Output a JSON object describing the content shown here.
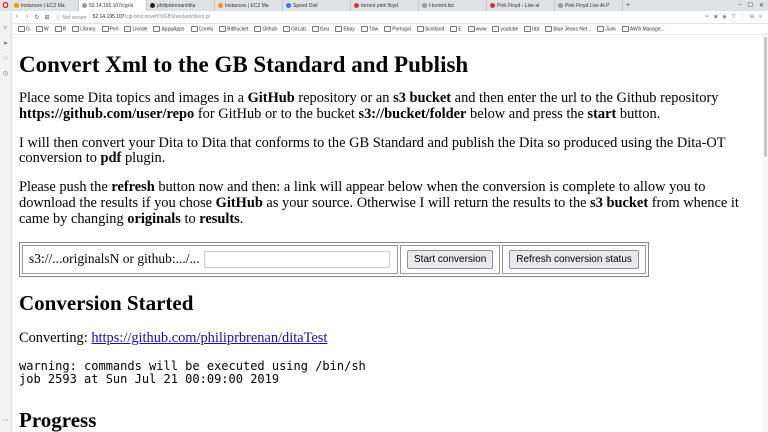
{
  "browser": {
    "tabs": [
      {
        "label": "Instances | EC2 Ma",
        "color": "#f29900",
        "active": false
      },
      {
        "label": "52.14.195.107/cgi-b",
        "color": "#999999",
        "active": true
      },
      {
        "label": "philiprbrenan/dita",
        "color": "#222222",
        "active": false
      },
      {
        "label": "Instances | EC2 Ma",
        "color": "#f29900",
        "active": false
      },
      {
        "label": "Speed Dial",
        "color": "#3478f6",
        "active": false
      },
      {
        "label": "torrent pink floyd",
        "color": "#d33",
        "active": false
      },
      {
        "label": "l-torrent.biz",
        "color": "#999999",
        "active": false
      },
      {
        "label": "Pink Floyd - Live at",
        "color": "#d33",
        "active": false
      },
      {
        "label": "Pink Floyd Live At P",
        "color": "#999999",
        "active": false
      }
    ],
    "new_tab": "+",
    "nav": {
      "back": "‹",
      "forward": "›",
      "reload": "↻",
      "grid": "⊞"
    },
    "security": "ⓘ Not secure",
    "url_host": "52.14.195.107",
    "url_path": "/cgi-bin/convertToGBStandard/client.pl",
    "bookmarks": [
      "G",
      "W",
      "R",
      "Library",
      "Perl",
      "Linode",
      "AppaApps",
      "Corelu",
      "BitBucket",
      "Github",
      "GitLab",
      "Gnu",
      "Ebay",
      "Tdw",
      "Portugal",
      "Scotland",
      "E",
      "www",
      "youtube",
      "bbt",
      "Blue Jeans Net...",
      "Junk",
      "AWS Manage..."
    ]
  },
  "page": {
    "title": "Convert Xml to the GB Standard and Publish",
    "p1": {
      "t1": "Place some Dita topics and images in a ",
      "b1": "GitHub",
      "t2": " repository or an ",
      "b2": "s3 bucket",
      "t3": " and then enter the url to the Github repository ",
      "b3": "https://github.com/user/repo",
      "t4": " for GitHub or to the bucket ",
      "b4": "s3://bucket/folder",
      "t5": " below and press the ",
      "b5": "start",
      "t6": " button."
    },
    "p2": {
      "t1": "I will then convert your Dita to Dita that conforms to the GB Standard and publish the Dita so produced using the Dita-OT conversion to ",
      "b1": "pdf",
      "t2": " plugin."
    },
    "p3": {
      "t1": "Please push the ",
      "b1": "refresh",
      "t2": " button now and then: a link will appear below when the conversion is complete to allow you to download the results if you chose ",
      "b2": "GitHub",
      "t3": " as your source. Otherwise I will return the results to the ",
      "b3": "s3 bucket",
      "t4": " from whence it came by changing ",
      "b4": "originals",
      "t5": " to ",
      "b5": "results",
      "t6": "."
    },
    "form": {
      "input_label": "s3://...originalsN or github:.../...",
      "input_value": "",
      "start_button": "Start conversion",
      "refresh_button": "Refresh conversion status"
    },
    "status_heading": "Conversion Started",
    "converting_label": "Converting: ",
    "converting_link": "https://github.com/philiprbrenan/ditaTest",
    "output_line1": "warning: commands will be executed using /bin/sh",
    "output_line2": "job 2593 at Sun Jul 21 00:09:00 2019",
    "next_heading": "Progress"
  }
}
